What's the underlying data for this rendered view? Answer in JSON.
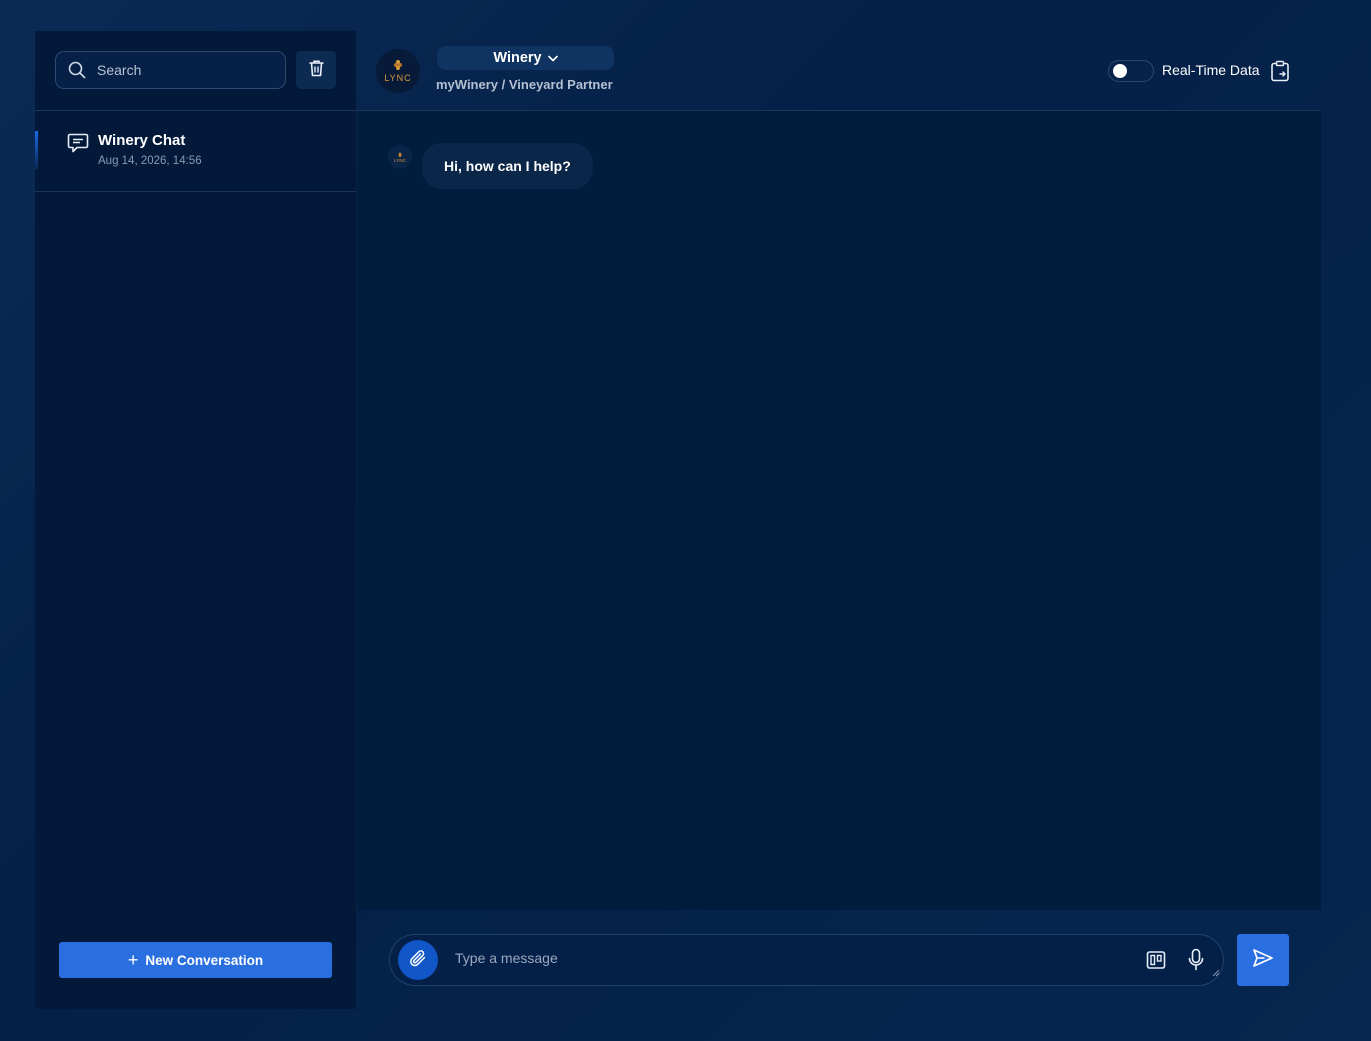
{
  "sidebar": {
    "search": {
      "placeholder": "Search",
      "value": ""
    },
    "conversations": [
      {
        "title": "Winery Chat",
        "date": "Aug 14, 2026, 14:56",
        "active": true
      }
    ],
    "new_conversation_label": "New Conversation"
  },
  "header": {
    "logo_text": "LYNC",
    "workspace_label": "Winery",
    "breadcrumb": "myWinery / Vineyard Partner",
    "realtime_label": "Real-Time Data",
    "realtime_enabled": false
  },
  "chat": {
    "avatar_text": "LYNC",
    "messages": [
      {
        "role": "assistant",
        "text": "Hi, how can I help?"
      }
    ]
  },
  "composer": {
    "placeholder": "Type a message",
    "value": ""
  },
  "colors": {
    "accent": "#2a6fe0",
    "attach": "#1257c8",
    "background": "#001d3d",
    "sidebar": "#02193a",
    "logo": "#d89a3c"
  },
  "icons": {
    "search": "search-icon",
    "trash": "trash-icon",
    "chat": "chat-icon",
    "chevron": "chevron-down-icon",
    "clipboard": "clipboard-icon",
    "attach": "paperclip-icon",
    "kanban": "kanban-icon",
    "mic": "microphone-icon",
    "send": "send-icon"
  }
}
